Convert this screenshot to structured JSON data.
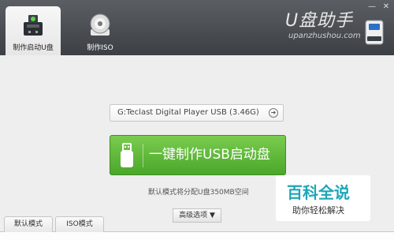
{
  "window": {
    "minimize_glyph": "—",
    "close_glyph": "✕"
  },
  "tabs": [
    {
      "label": "制作启动U盘",
      "icon": "usb-drive-icon",
      "active": true
    },
    {
      "label": "制作ISO",
      "icon": "disc-icon",
      "active": false
    }
  ],
  "brand": {
    "title": "U盘助手",
    "url": "upanzhushou.com",
    "logo_icon": "usb-stick-logo-icon"
  },
  "main": {
    "drive_selected": "G:Teclast Digital Player USB (3.46G)",
    "drive_arrow_icon": "circle-arrow-right-icon",
    "make_button_label": "一键制作USB启动盘",
    "make_button_icon": "usb-plug-icon",
    "hint": "默认模式将分配U盘350MB空间"
  },
  "bottom": {
    "mode_tabs": [
      {
        "label": "默认模式"
      },
      {
        "label": "ISO模式"
      }
    ],
    "advanced_label": "高级选项",
    "advanced_glyph": "▼"
  },
  "watermark": {
    "title": "百科全说",
    "subtitle": "助你轻松解决"
  },
  "colors": {
    "accent_green": "#5bb83a",
    "title_bar": "#4a4e53",
    "watermark_teal": "#1ea6b8"
  }
}
